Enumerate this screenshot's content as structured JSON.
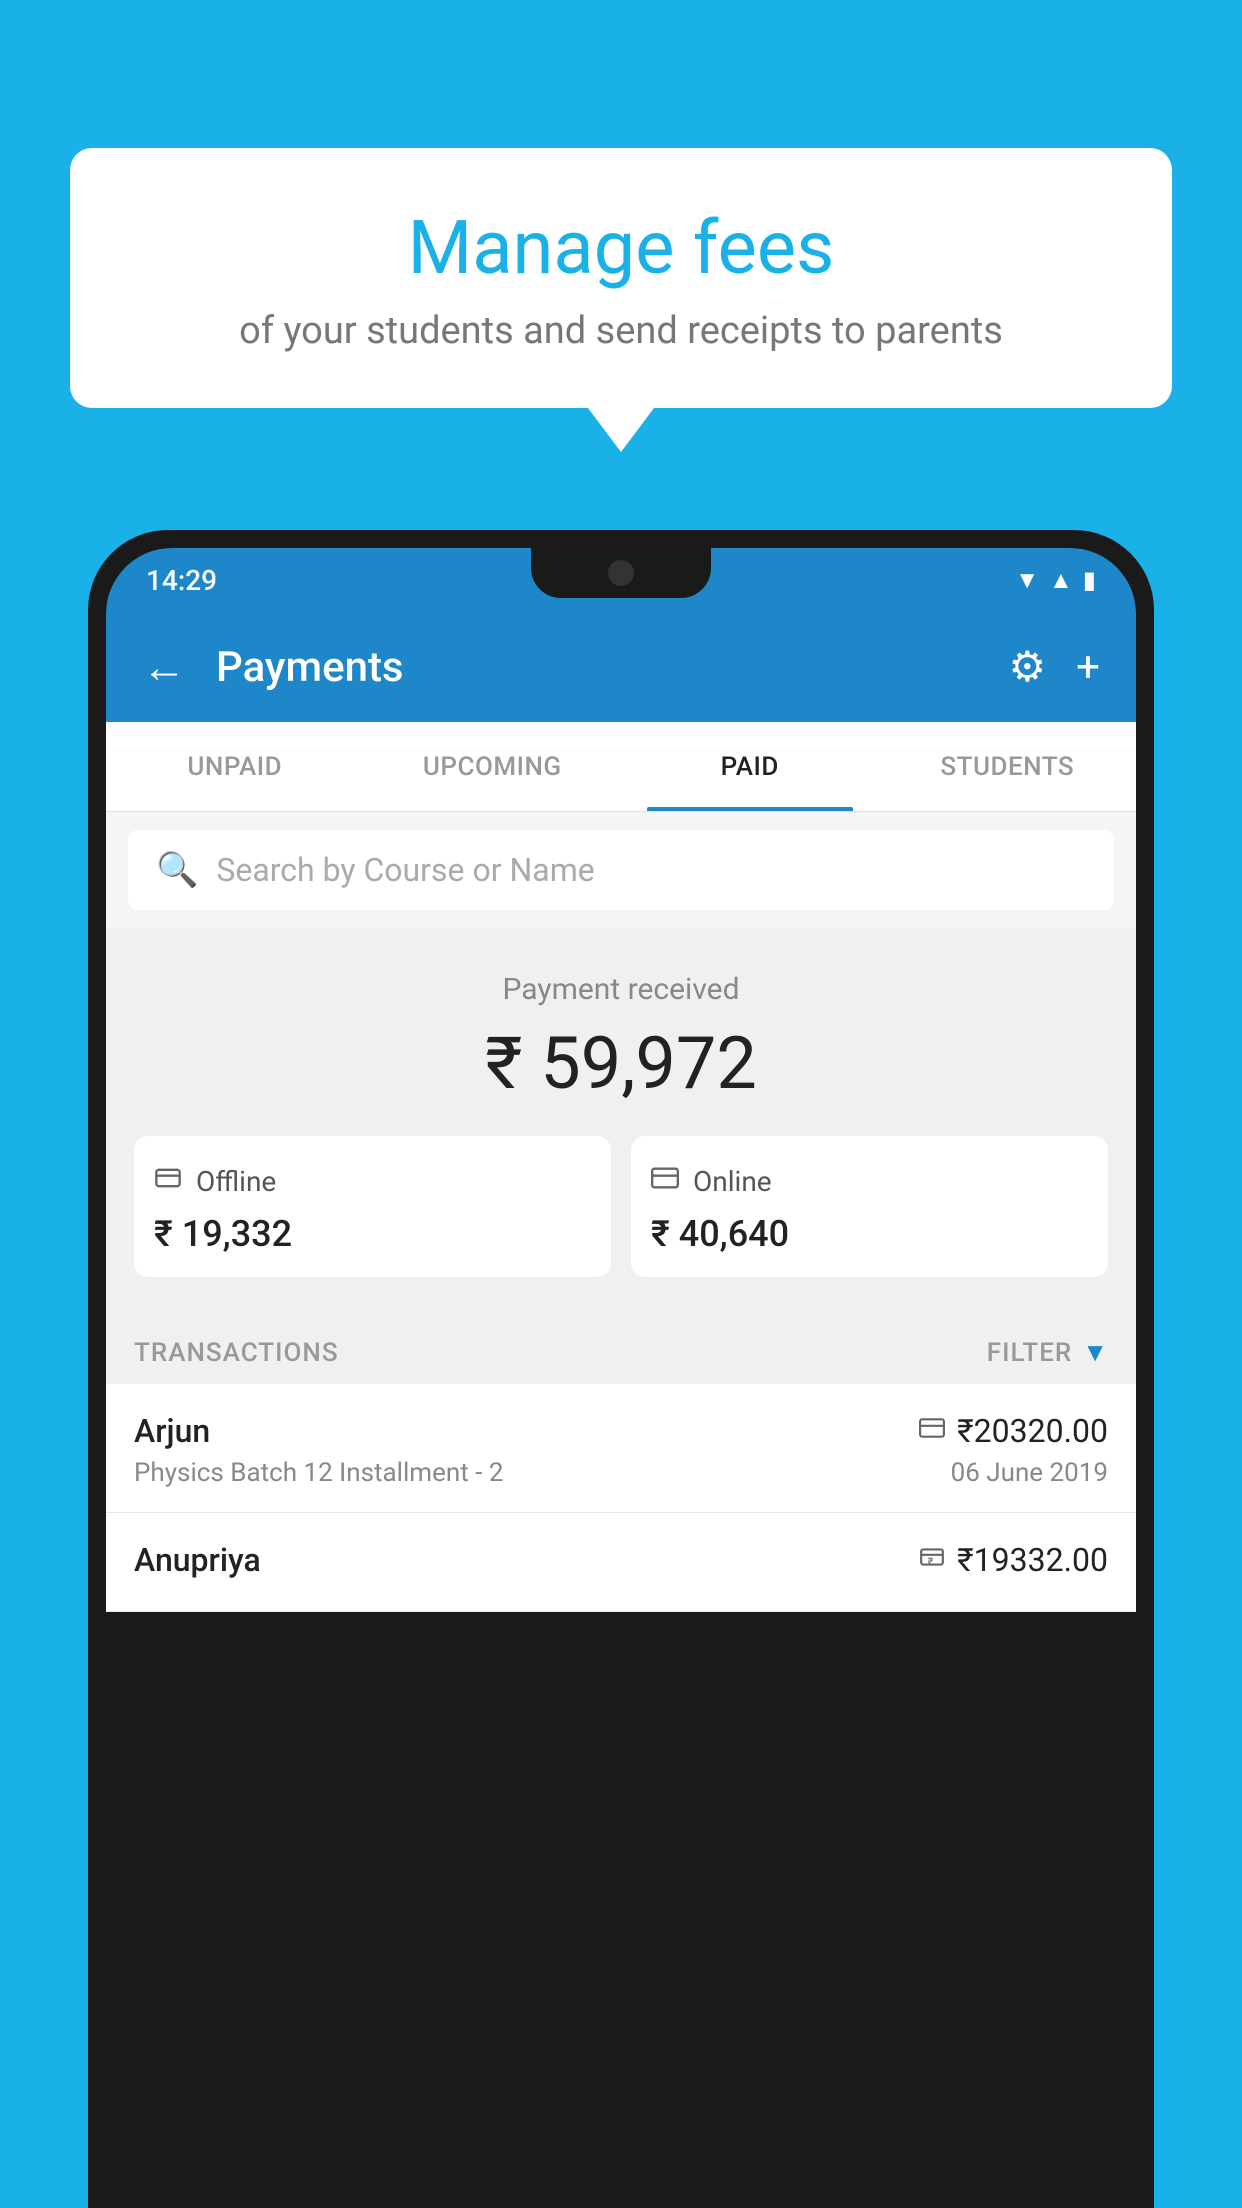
{
  "background_color": "#1ab0e8",
  "bubble": {
    "title": "Manage fees",
    "subtitle": "of your students and send receipts to parents"
  },
  "status_bar": {
    "time": "14:29",
    "wifi_icon": "▲",
    "signal_icon": "▲",
    "battery_icon": "▮"
  },
  "app_bar": {
    "title": "Payments",
    "back_label": "←",
    "gear_label": "⚙",
    "plus_label": "+"
  },
  "tabs": [
    {
      "id": "unpaid",
      "label": "UNPAID",
      "active": false
    },
    {
      "id": "upcoming",
      "label": "UPCOMING",
      "active": false
    },
    {
      "id": "paid",
      "label": "PAID",
      "active": true
    },
    {
      "id": "students",
      "label": "STUDENTS",
      "active": false
    }
  ],
  "search": {
    "placeholder": "Search by Course or Name"
  },
  "payment_summary": {
    "label": "Payment received",
    "amount": "₹ 59,972",
    "offline": {
      "icon": "₹",
      "label": "Offline",
      "amount": "₹ 19,332"
    },
    "online": {
      "icon": "💳",
      "label": "Online",
      "amount": "₹ 40,640"
    }
  },
  "transactions_section": {
    "label": "TRANSACTIONS",
    "filter_label": "FILTER"
  },
  "transactions": [
    {
      "name": "Arjun",
      "type_icon": "💳",
      "amount": "₹20320.00",
      "course": "Physics Batch 12 Installment - 2",
      "date": "06 June 2019"
    },
    {
      "name": "Anupriya",
      "type_icon": "₹",
      "amount": "₹19332.00",
      "course": "",
      "date": ""
    }
  ]
}
